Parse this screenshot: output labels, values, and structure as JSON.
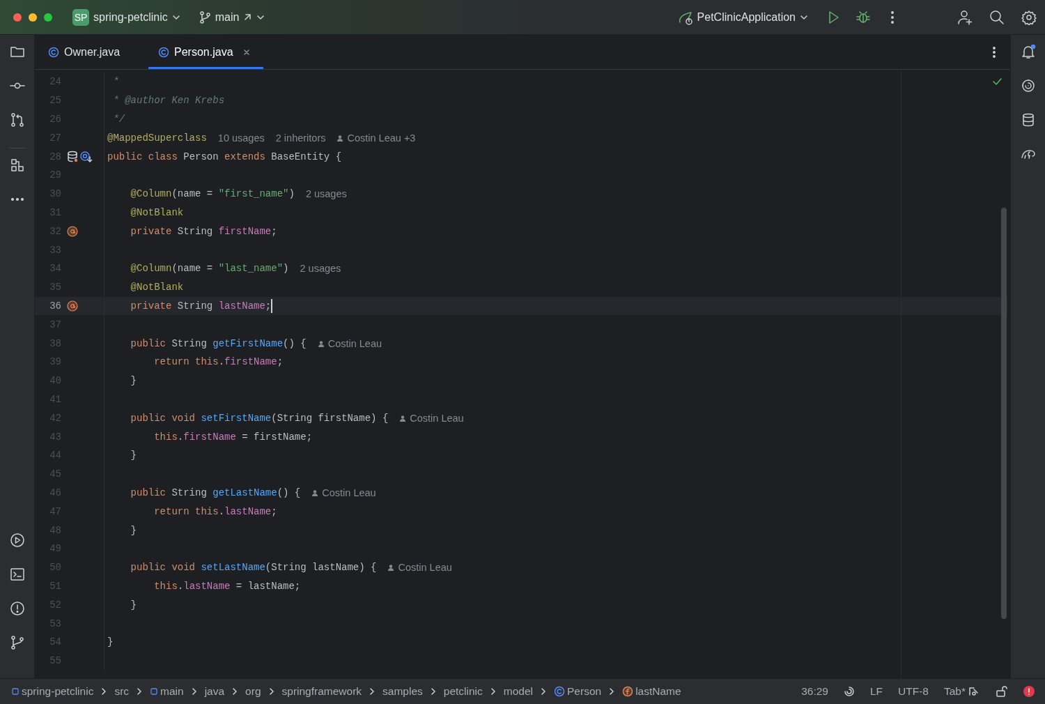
{
  "title_bar": {
    "project_badge": "SP",
    "project": "spring-petclinic",
    "branch": "main",
    "run_config": "PetClinicApplication"
  },
  "tabs": [
    {
      "label": "Owner.java",
      "selected": false
    },
    {
      "label": "Person.java",
      "selected": true
    }
  ],
  "editor": {
    "lines": [
      {
        "number": "24",
        "current": false,
        "tokens": [
          {
            "kind": "doc",
            "text": " *"
          }
        ]
      },
      {
        "number": "25",
        "current": false,
        "tokens": [
          {
            "kind": "doc",
            "text": " * @author Ken Krebs"
          }
        ]
      },
      {
        "number": "26",
        "current": false,
        "tokens": [
          {
            "kind": "doc",
            "text": " */"
          }
        ]
      },
      {
        "number": "27",
        "current": false,
        "tokens": [
          {
            "kind": "annotation",
            "text": "@MappedSuperclass"
          }
        ],
        "hints": [
          {
            "kind": "usages",
            "text": "10 usages"
          },
          {
            "kind": "usages",
            "text": "2 inheritors"
          },
          {
            "kind": "author",
            "text": "Costin Leau +3"
          }
        ]
      },
      {
        "number": "28",
        "current": false,
        "gutter": [
          {
            "kind": "database"
          },
          {
            "kind": "implemented"
          }
        ],
        "tokens": [
          {
            "kind": "keyword",
            "text": "public class"
          },
          {
            "kind": "plain",
            "text": " Person "
          },
          {
            "kind": "keyword",
            "text": "extends"
          },
          {
            "kind": "plain",
            "text": " BaseEntity {"
          }
        ]
      },
      {
        "number": "29",
        "current": false
      },
      {
        "number": "30",
        "current": false,
        "tokens": [
          {
            "kind": "annotation",
            "text": "    @Column"
          },
          {
            "kind": "plain",
            "text": "(name = "
          },
          {
            "kind": "string",
            "text": "\"first_name\""
          },
          {
            "kind": "plain",
            "text": ")"
          }
        ],
        "hints": [
          {
            "kind": "usages",
            "text": "2 usages"
          }
        ]
      },
      {
        "number": "31",
        "current": false,
        "tokens": [
          {
            "kind": "annotation",
            "text": "    @NotBlank"
          }
        ]
      },
      {
        "number": "32",
        "current": false,
        "gutter": [
          {
            "kind": "field"
          }
        ],
        "tokens": [
          {
            "kind": "keyword",
            "text": "    private"
          },
          {
            "kind": "plain",
            "text": " String "
          },
          {
            "kind": "field",
            "text": "firstName"
          },
          {
            "kind": "plain",
            "text": ";"
          }
        ]
      },
      {
        "number": "33",
        "current": false
      },
      {
        "number": "34",
        "current": false,
        "tokens": [
          {
            "kind": "annotation",
            "text": "    @Column"
          },
          {
            "kind": "plain",
            "text": "(name = "
          },
          {
            "kind": "string",
            "text": "\"last_name\""
          },
          {
            "kind": "plain",
            "text": ")"
          }
        ],
        "hints": [
          {
            "kind": "usages",
            "text": "2 usages"
          }
        ]
      },
      {
        "number": "35",
        "current": false,
        "tokens": [
          {
            "kind": "annotation",
            "text": "    @NotBlank"
          }
        ]
      },
      {
        "number": "36",
        "current": true,
        "caret": true,
        "gutter": [
          {
            "kind": "field"
          }
        ],
        "tokens": [
          {
            "kind": "keyword",
            "text": "    private"
          },
          {
            "kind": "plain",
            "text": " String "
          },
          {
            "kind": "field",
            "text": "lastName"
          },
          {
            "kind": "plain",
            "text": ";"
          }
        ]
      },
      {
        "number": "37",
        "current": false
      },
      {
        "number": "38",
        "current": false,
        "tokens": [
          {
            "kind": "keyword",
            "text": "    public"
          },
          {
            "kind": "plain",
            "text": " String "
          },
          {
            "kind": "method",
            "text": "getFirstName"
          },
          {
            "kind": "plain",
            "text": "() {"
          }
        ],
        "hints": [
          {
            "kind": "author",
            "text": "Costin Leau"
          }
        ]
      },
      {
        "number": "39",
        "current": false,
        "tokens": [
          {
            "kind": "keyword",
            "text": "        return this"
          },
          {
            "kind": "plain",
            "text": "."
          },
          {
            "kind": "field",
            "text": "firstName"
          },
          {
            "kind": "plain",
            "text": ";"
          }
        ]
      },
      {
        "number": "40",
        "current": false,
        "tokens": [
          {
            "kind": "plain",
            "text": "    }"
          }
        ]
      },
      {
        "number": "41",
        "current": false
      },
      {
        "number": "42",
        "current": false,
        "tokens": [
          {
            "kind": "keyword",
            "text": "    public void "
          },
          {
            "kind": "method",
            "text": "setFirstName"
          },
          {
            "kind": "plain",
            "text": "(String firstName) {"
          }
        ],
        "hints": [
          {
            "kind": "author",
            "text": "Costin Leau"
          }
        ]
      },
      {
        "number": "43",
        "current": false,
        "tokens": [
          {
            "kind": "keyword",
            "text": "        this"
          },
          {
            "kind": "plain",
            "text": "."
          },
          {
            "kind": "field",
            "text": "firstName"
          },
          {
            "kind": "plain",
            "text": " = firstName;"
          }
        ]
      },
      {
        "number": "44",
        "current": false,
        "tokens": [
          {
            "kind": "plain",
            "text": "    }"
          }
        ]
      },
      {
        "number": "45",
        "current": false
      },
      {
        "number": "46",
        "current": false,
        "tokens": [
          {
            "kind": "keyword",
            "text": "    public"
          },
          {
            "kind": "plain",
            "text": " String "
          },
          {
            "kind": "method",
            "text": "getLastName"
          },
          {
            "kind": "plain",
            "text": "() {"
          }
        ],
        "hints": [
          {
            "kind": "author",
            "text": "Costin Leau"
          }
        ]
      },
      {
        "number": "47",
        "current": false,
        "tokens": [
          {
            "kind": "keyword",
            "text": "        return this"
          },
          {
            "kind": "plain",
            "text": "."
          },
          {
            "kind": "field",
            "text": "lastName"
          },
          {
            "kind": "plain",
            "text": ";"
          }
        ]
      },
      {
        "number": "48",
        "current": false,
        "tokens": [
          {
            "kind": "plain",
            "text": "    }"
          }
        ]
      },
      {
        "number": "49",
        "current": false
      },
      {
        "number": "50",
        "current": false,
        "tokens": [
          {
            "kind": "keyword",
            "text": "    public void "
          },
          {
            "kind": "method",
            "text": "setLastName"
          },
          {
            "kind": "plain",
            "text": "(String lastName) {"
          }
        ],
        "hints": [
          {
            "kind": "author",
            "text": "Costin Leau"
          }
        ]
      },
      {
        "number": "51",
        "current": false,
        "tokens": [
          {
            "kind": "keyword",
            "text": "        this"
          },
          {
            "kind": "plain",
            "text": "."
          },
          {
            "kind": "field",
            "text": "lastName"
          },
          {
            "kind": "plain",
            "text": " = lastName;"
          }
        ]
      },
      {
        "number": "52",
        "current": false,
        "tokens": [
          {
            "kind": "plain",
            "text": "    }"
          }
        ]
      },
      {
        "number": "53",
        "current": false
      },
      {
        "number": "54",
        "current": false,
        "tokens": [
          {
            "kind": "plain",
            "text": "}"
          }
        ]
      },
      {
        "number": "55",
        "current": false
      }
    ]
  },
  "status_bar": {
    "breadcrumbs": [
      {
        "kind": "module",
        "text": "spring-petclinic"
      },
      {
        "kind": "folder",
        "text": "src"
      },
      {
        "kind": "module",
        "text": "main"
      },
      {
        "kind": "folder",
        "text": "java"
      },
      {
        "kind": "folder",
        "text": "org"
      },
      {
        "kind": "folder",
        "text": "springframework"
      },
      {
        "kind": "folder",
        "text": "samples"
      },
      {
        "kind": "folder",
        "text": "petclinic"
      },
      {
        "kind": "folder",
        "text": "model"
      },
      {
        "kind": "class",
        "text": "Person"
      },
      {
        "kind": "field",
        "text": "lastName"
      }
    ],
    "position": "36:29",
    "line_separator": "LF",
    "encoding": "UTF-8",
    "indent": "Tab*"
  }
}
